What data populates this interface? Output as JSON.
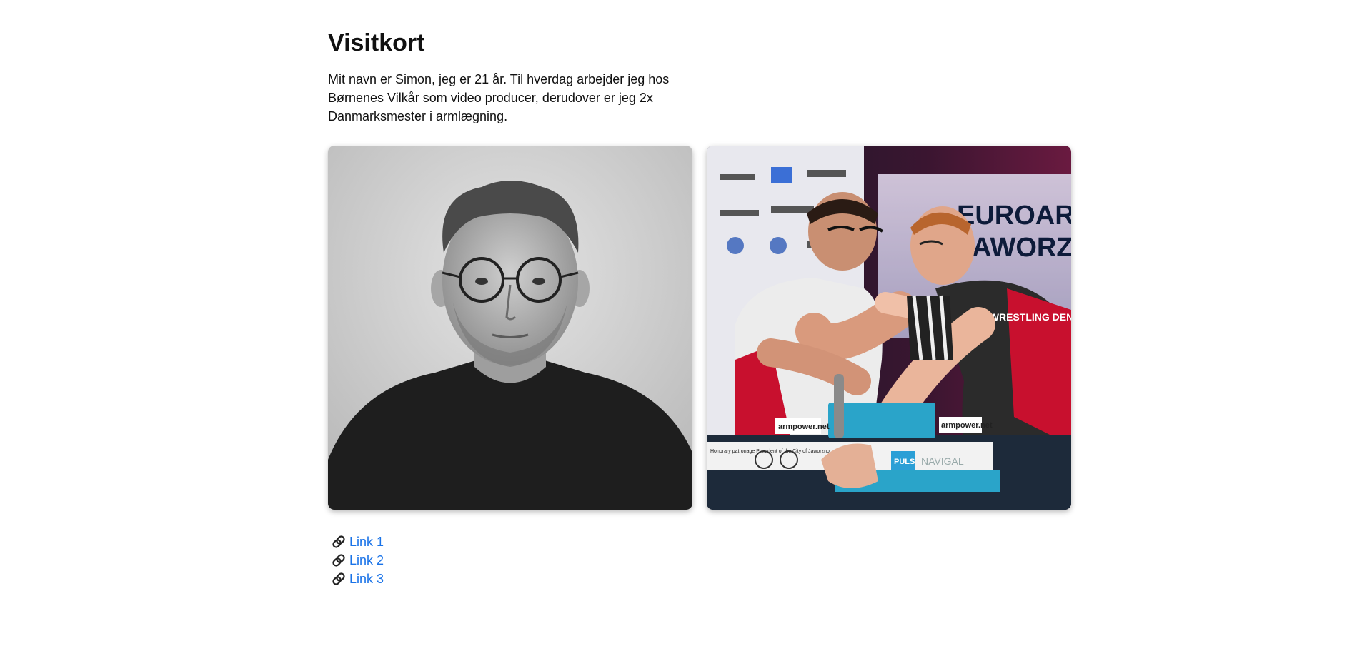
{
  "header": {
    "title": "Visitkort"
  },
  "intro": {
    "text": "Mit navn er Simon, jeg er 21 år. Til hverdag arbejder jeg hos Børnenes Vilkår som video producer, derudover er jeg 2x Danmarksmester i armlægning."
  },
  "photos": {
    "portrait_icon": "portrait-photo",
    "armwrestling_icon": "armwrestling-photo",
    "banner_line1": "EUROARM",
    "banner_line2": "JAWORZN",
    "table_sign_left": "armpower.net",
    "table_sign_right": "armpower.net",
    "sponsor_text": "Honorary patronage President of the City of Jaworzno",
    "sponsor_puls": "PULS",
    "sponsor_navigal": "NAVIGAL",
    "shirt_text": "ARM WRESTLING DENMARK"
  },
  "links": {
    "items": [
      {
        "label": "Link 1",
        "icon": "link-icon"
      },
      {
        "label": "Link 2",
        "icon": "link-icon"
      },
      {
        "label": "Link 3",
        "icon": "link-icon"
      }
    ],
    "color": "#1a73e8"
  }
}
